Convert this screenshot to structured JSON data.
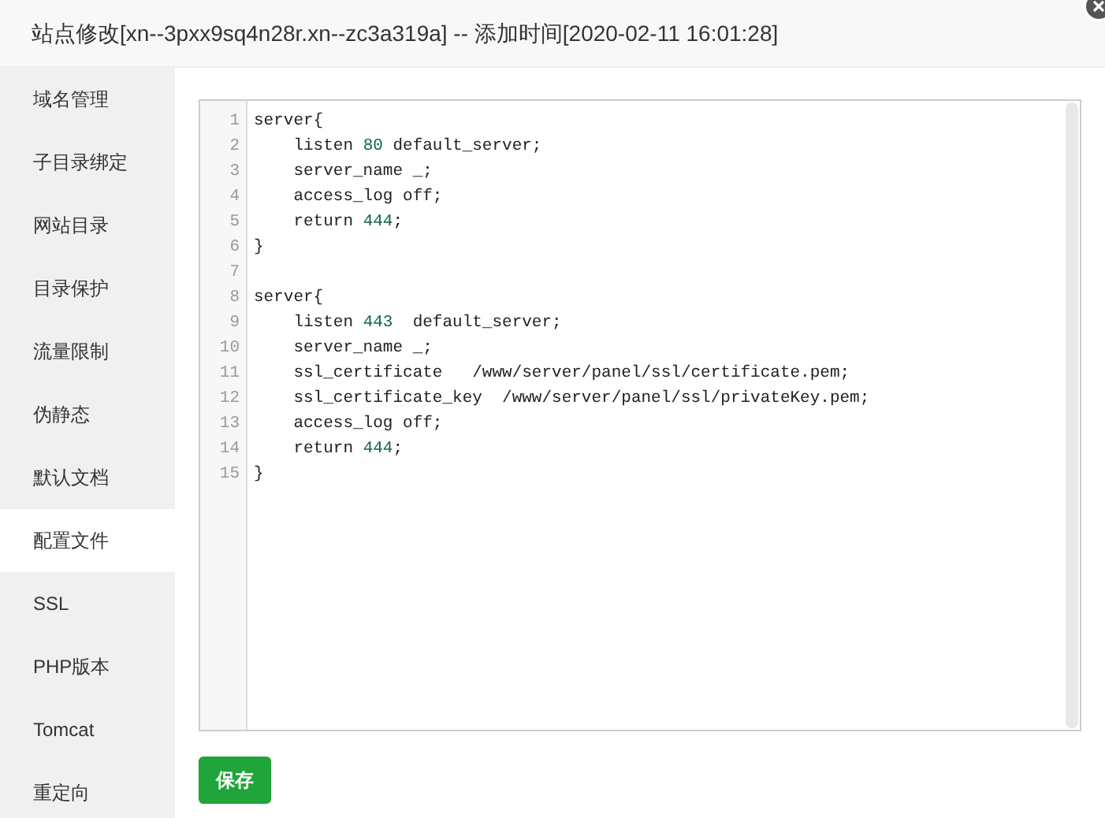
{
  "window": {
    "title": "站点修改[xn--3pxx9sq4n28r.xn--zc3a319a] -- 添加时间[2020-02-11 16:01:28]"
  },
  "sidebar": {
    "items": [
      {
        "label": "域名管理",
        "selected": false
      },
      {
        "label": "子目录绑定",
        "selected": false
      },
      {
        "label": "网站目录",
        "selected": false
      },
      {
        "label": "目录保护",
        "selected": false
      },
      {
        "label": "流量限制",
        "selected": false
      },
      {
        "label": "伪静态",
        "selected": false
      },
      {
        "label": "默认文档",
        "selected": false
      },
      {
        "label": "配置文件",
        "selected": true
      },
      {
        "label": "SSL",
        "selected": false
      },
      {
        "label": "PHP版本",
        "selected": false
      },
      {
        "label": "Tomcat",
        "selected": false
      },
      {
        "label": "重定向",
        "selected": false
      }
    ]
  },
  "editor": {
    "lines": [
      {
        "number": "1",
        "parts": [
          {
            "kind": "plain",
            "text": "server{"
          }
        ]
      },
      {
        "number": "2",
        "parts": [
          {
            "kind": "plain",
            "text": "    listen "
          },
          {
            "kind": "number",
            "text": "80"
          },
          {
            "kind": "plain",
            "text": " default_server;"
          }
        ]
      },
      {
        "number": "3",
        "parts": [
          {
            "kind": "plain",
            "text": "    server_name _;"
          }
        ]
      },
      {
        "number": "4",
        "parts": [
          {
            "kind": "plain",
            "text": "    access_log off;"
          }
        ]
      },
      {
        "number": "5",
        "parts": [
          {
            "kind": "plain",
            "text": "    return "
          },
          {
            "kind": "number",
            "text": "444"
          },
          {
            "kind": "plain",
            "text": ";"
          }
        ]
      },
      {
        "number": "6",
        "parts": [
          {
            "kind": "plain",
            "text": "}"
          }
        ]
      },
      {
        "number": "7"
      },
      {
        "number": "8",
        "parts": [
          {
            "kind": "plain",
            "text": "server{"
          }
        ]
      },
      {
        "number": "9",
        "parts": [
          {
            "kind": "plain",
            "text": "    listen "
          },
          {
            "kind": "number",
            "text": "443"
          },
          {
            "kind": "plain",
            "text": "  default_server;"
          }
        ]
      },
      {
        "number": "10",
        "parts": [
          {
            "kind": "plain",
            "text": "    server_name _;"
          }
        ]
      },
      {
        "number": "11",
        "parts": [
          {
            "kind": "plain",
            "text": "    ssl_certificate   /www/server/panel/ssl/certificate.pem;"
          }
        ]
      },
      {
        "number": "12",
        "parts": [
          {
            "kind": "plain",
            "text": "    ssl_certificate_key  /www/server/panel/ssl/privateKey.pem;"
          }
        ]
      },
      {
        "number": "13",
        "parts": [
          {
            "kind": "plain",
            "text": "    access_log off;"
          }
        ]
      },
      {
        "number": "14",
        "parts": [
          {
            "kind": "plain",
            "text": "    return "
          },
          {
            "kind": "number",
            "text": "444"
          },
          {
            "kind": "plain",
            "text": ";"
          }
        ]
      },
      {
        "number": "15",
        "parts": [
          {
            "kind": "plain",
            "text": "}"
          }
        ]
      }
    ]
  },
  "buttons": {
    "save": "保存"
  }
}
